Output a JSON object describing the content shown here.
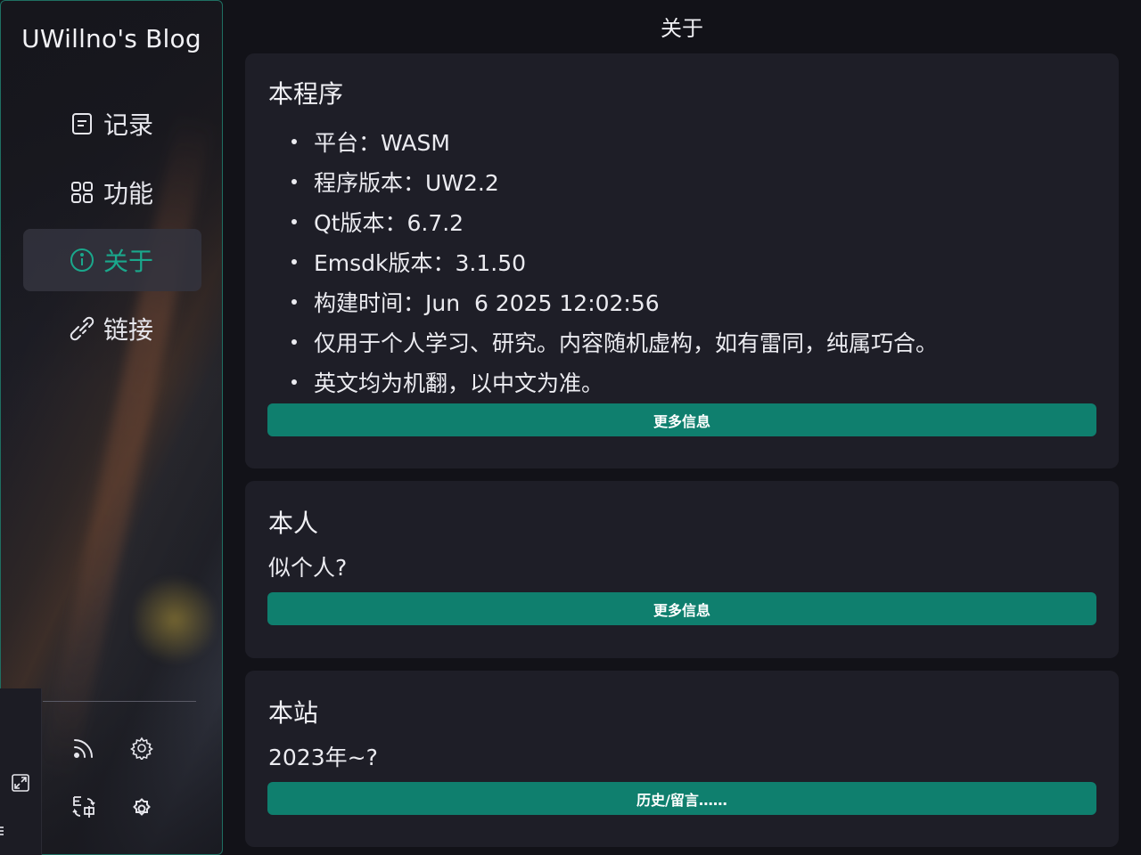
{
  "sidebar": {
    "title": "UWillno's Blog",
    "items": [
      {
        "label": "记录",
        "icon": "document-icon"
      },
      {
        "label": "功能",
        "icon": "grid-icon"
      },
      {
        "label": "关于",
        "icon": "info-icon",
        "active": true
      },
      {
        "label": "链接",
        "icon": "link-icon"
      }
    ],
    "bottom_icons": [
      "rss-icon",
      "settings-icon",
      "translate-icon",
      "theme-settings-icon"
    ],
    "dock_icons": [
      "expand-icon",
      "menu-icon"
    ]
  },
  "header": {
    "title": "关于"
  },
  "cards": [
    {
      "title": "本程序",
      "items": [
        "平台：WASM",
        "程序版本：UW2.2",
        "Qt版本：6.7.2",
        "Emsdk版本：3.1.50",
        "构建时间：Jun  6 2025 12:02:56",
        "仅用于个人学习、研究。内容随机虚构，如有雷同，纯属巧合。",
        "英文均为机翻，以中文为准。"
      ],
      "button": "更多信息"
    },
    {
      "title": "本人",
      "text": "似个人?",
      "button": "更多信息"
    },
    {
      "title": "本站",
      "text": "2023年~?",
      "button": "历史/留言……"
    }
  ],
  "colors": {
    "accent": "#0f7f6e",
    "active_text": "#1aa88c",
    "background": "#121218",
    "card": "#1e1e27"
  }
}
